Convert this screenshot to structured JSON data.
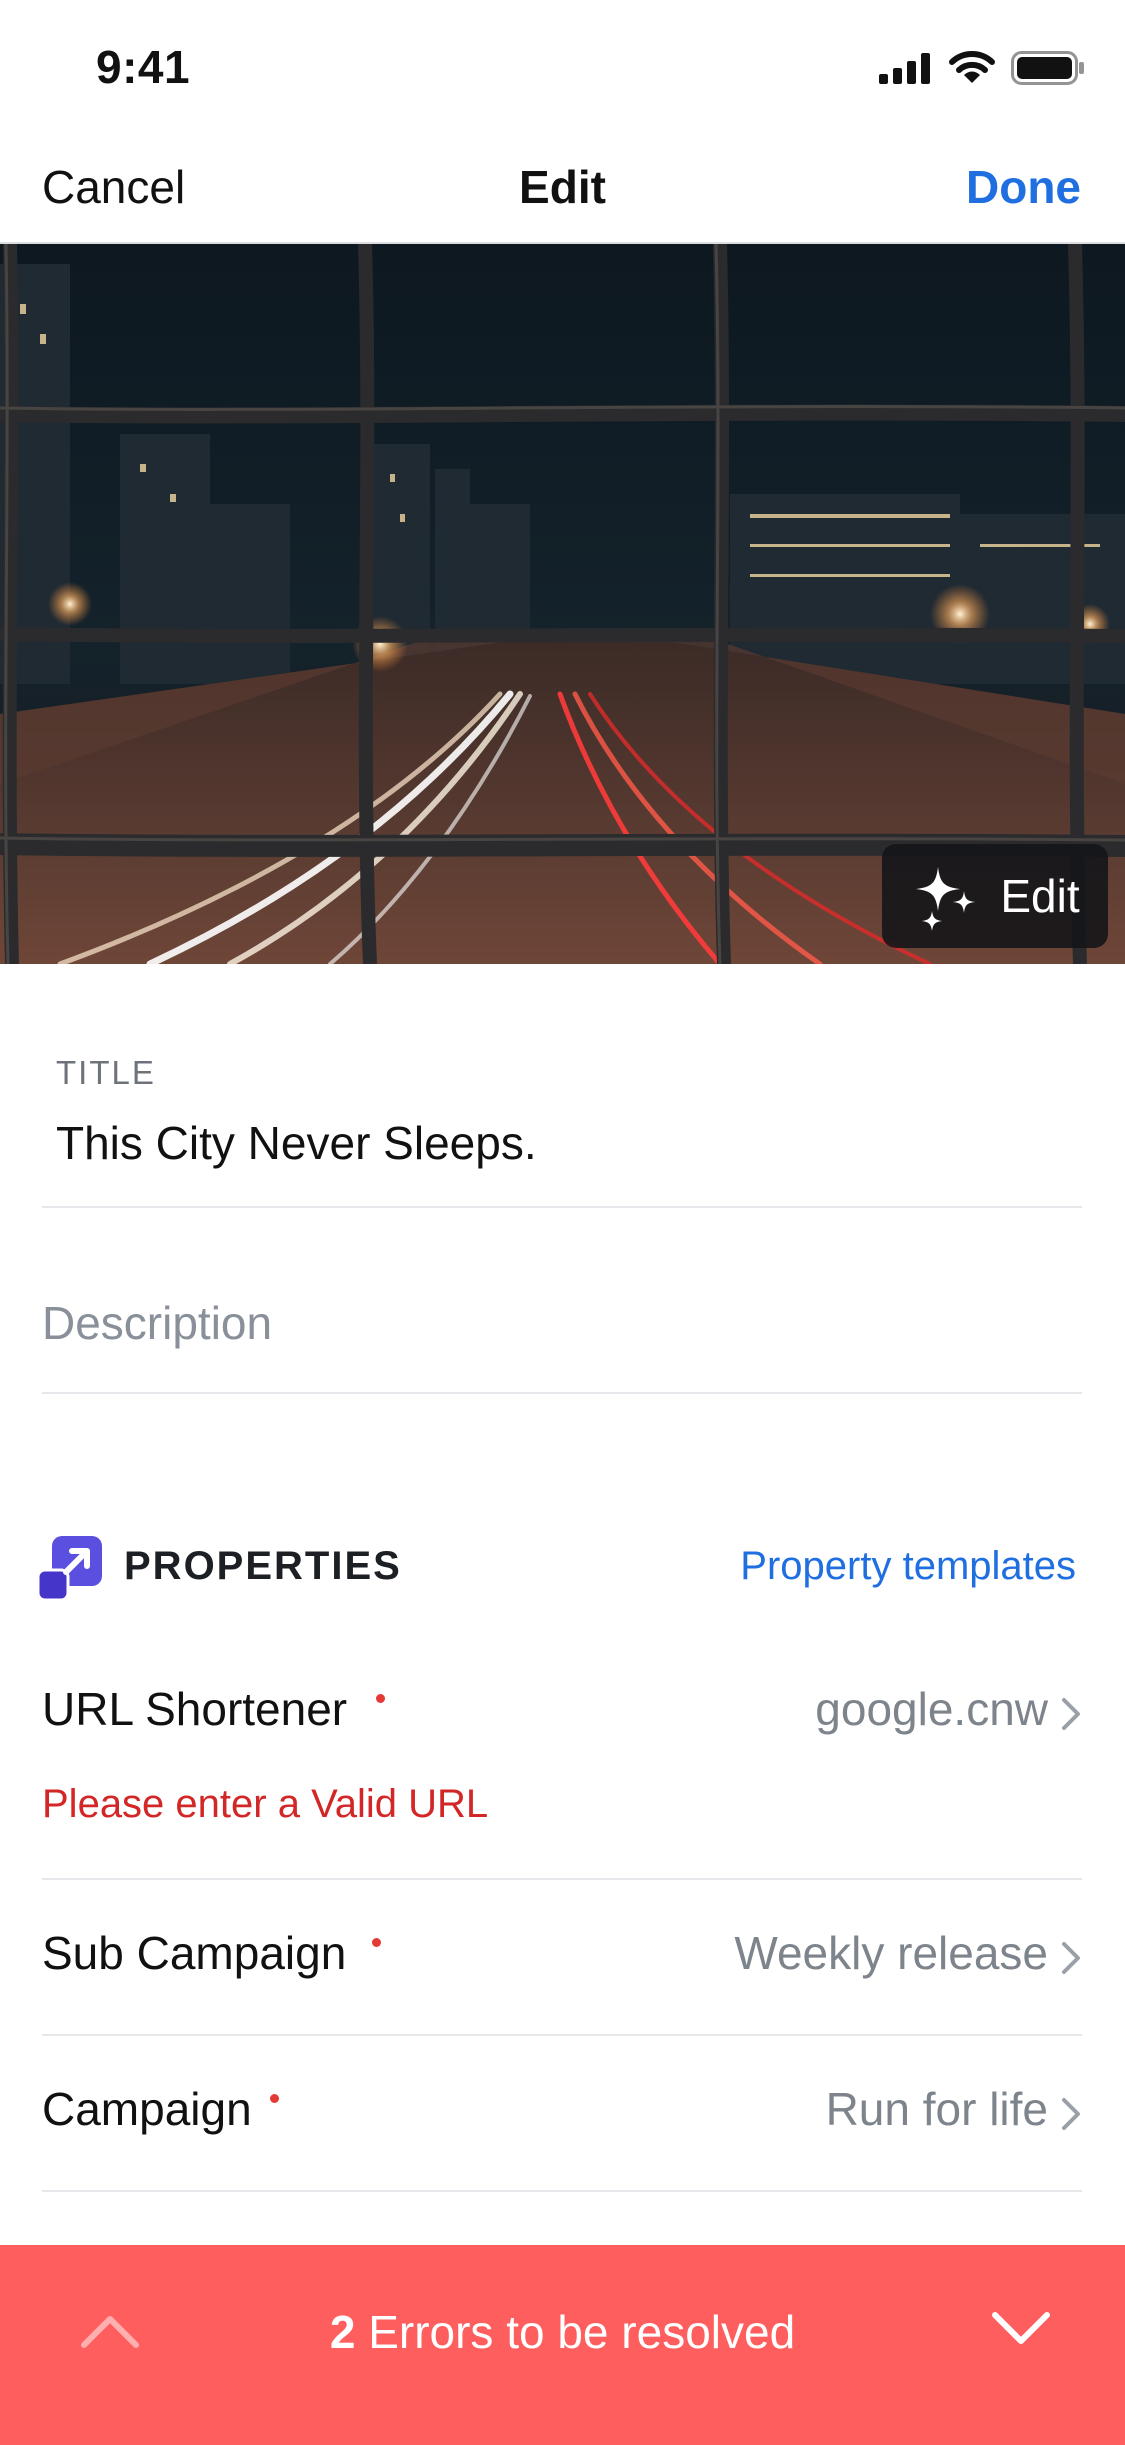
{
  "status_bar": {
    "time": "9:41",
    "icons": [
      "signal-icon",
      "wifi-icon",
      "battery-icon"
    ]
  },
  "nav": {
    "cancel_label": "Cancel",
    "title": "Edit",
    "done_label": "Done"
  },
  "photo": {
    "edit_label": "Edit",
    "edit_icon": "sparkles-icon"
  },
  "title_field": {
    "label": "TITLE",
    "value": "This City Never Sleeps."
  },
  "description_field": {
    "value": "",
    "placeholder": "Description"
  },
  "properties": {
    "icon": "properties-icon",
    "title": "PROPERTIES",
    "templates_label": "Property templates",
    "rows": [
      {
        "label": "URL Shortener",
        "value": "google.cnw",
        "required": true,
        "error": "Please enter a Valid URL"
      },
      {
        "label": "Sub Campaign",
        "value": "Weekly release",
        "required": true
      },
      {
        "label": "Campaign",
        "value": "Run for life",
        "required": true
      }
    ]
  },
  "error_bar": {
    "count": "2",
    "message": "Errors to be resolved",
    "prev_icon": "chevron-up-icon",
    "next_icon": "chevron-down-icon"
  },
  "colors": {
    "accent": "#1f6fe0",
    "error_text": "#d32626",
    "error_bar": "#ff5e5e",
    "required_dot": "#e53935",
    "properties_icon": "#5b4fe0"
  }
}
